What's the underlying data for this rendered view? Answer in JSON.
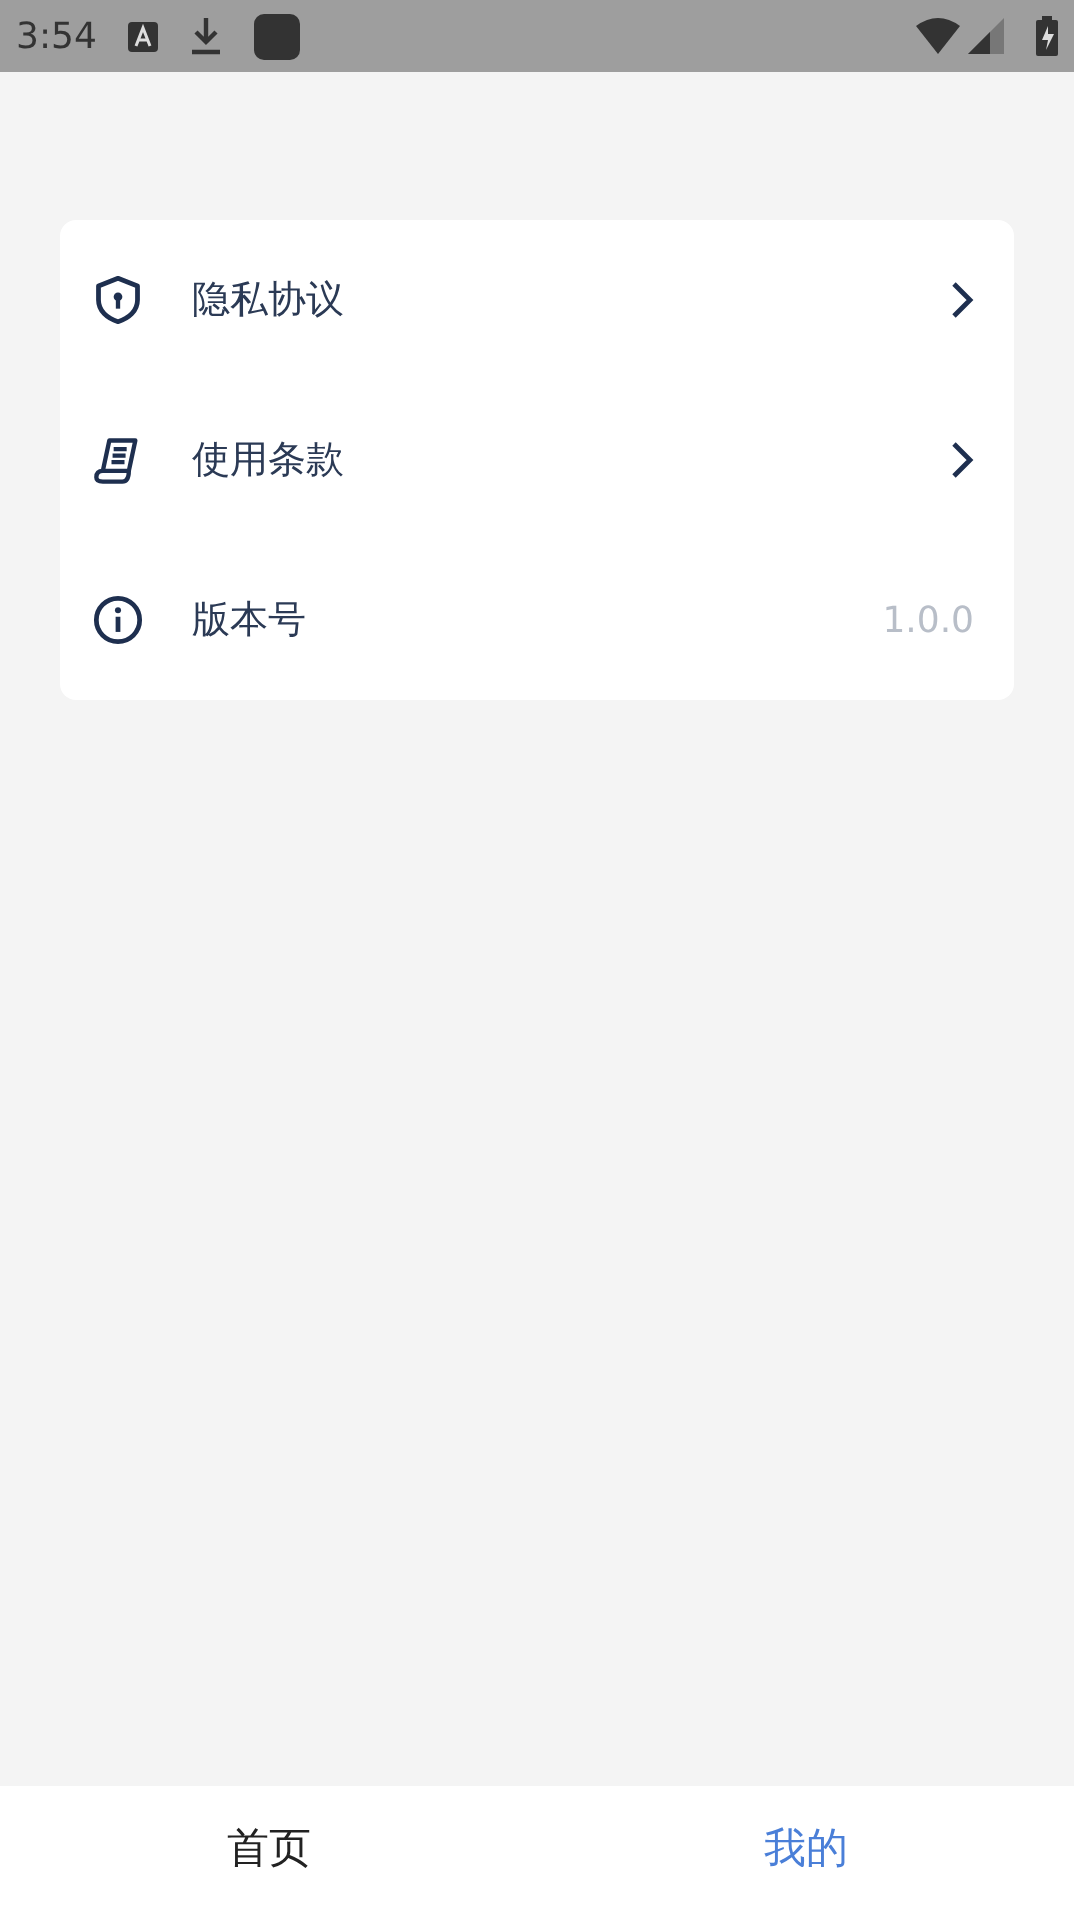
{
  "status_bar": {
    "time": "3:54"
  },
  "menu": [
    {
      "kind": "link",
      "label": "隐私协议"
    },
    {
      "kind": "link",
      "label": "使用条款"
    },
    {
      "kind": "value",
      "label": "版本号",
      "value": "1.0.0"
    }
  ],
  "tabs": [
    {
      "label": "首页",
      "selected": false
    },
    {
      "label": "我的",
      "selected": true
    }
  ]
}
